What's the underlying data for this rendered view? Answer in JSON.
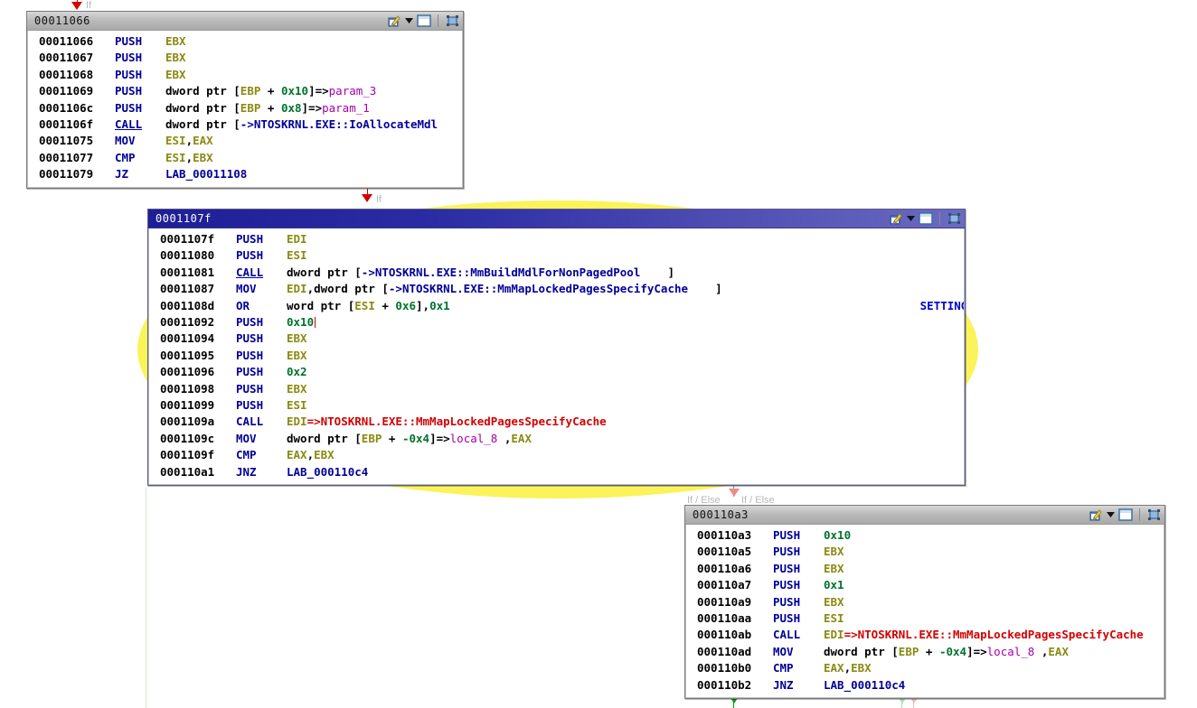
{
  "app": {
    "view": "function-graph",
    "accent_blue": "#00009a",
    "accent_red": "#d40000",
    "highlight_yellow": "#fbf35a",
    "register_olive": "#8a8a12",
    "number_green": "#00722a",
    "variable_magenta": "#a800a8"
  },
  "edges": [
    {
      "id": "edge-into-block-1",
      "label": "If"
    },
    {
      "id": "edge-block1-to-block2",
      "label": "If"
    },
    {
      "id": "edge-block2-to-block3-a",
      "label": "If / Else"
    },
    {
      "id": "edge-block2-to-block3-b",
      "label": "If / Else"
    }
  ],
  "titlebar_icons": [
    {
      "name": "edit-highlight-icon",
      "glyph": ""
    },
    {
      "name": "chevron-down-icon",
      "glyph": "▾"
    },
    {
      "name": "window-restore-icon",
      "glyph": ""
    },
    {
      "name": "fit-to-window-icon",
      "glyph": ""
    }
  ],
  "blocks": [
    {
      "id": "block-00011066",
      "title": "00011066",
      "selected": false,
      "rows": [
        {
          "addr": "00011066",
          "mnem": "PUSH",
          "underline": false,
          "ops": [
            {
              "t": "reg",
              "v": "EBX"
            }
          ],
          "comment": ""
        },
        {
          "addr": "00011067",
          "mnem": "PUSH",
          "underline": false,
          "ops": [
            {
              "t": "reg",
              "v": "EBX"
            }
          ],
          "comment": ""
        },
        {
          "addr": "00011068",
          "mnem": "PUSH",
          "underline": false,
          "ops": [
            {
              "t": "reg",
              "v": "EBX"
            }
          ],
          "comment": ""
        },
        {
          "addr": "00011069",
          "mnem": "PUSH",
          "underline": false,
          "ops": [
            {
              "t": "plain",
              "v": "dword ptr ["
            },
            {
              "t": "reg",
              "v": "EBP"
            },
            {
              "t": "plain",
              "v": " + "
            },
            {
              "t": "num",
              "v": "0x10"
            },
            {
              "t": "plain",
              "v": "]=>"
            },
            {
              "t": "var",
              "v": "param_3"
            }
          ],
          "comment": ""
        },
        {
          "addr": "0001106c",
          "mnem": "PUSH",
          "underline": false,
          "ops": [
            {
              "t": "plain",
              "v": "dword ptr ["
            },
            {
              "t": "reg",
              "v": "EBP"
            },
            {
              "t": "plain",
              "v": " + "
            },
            {
              "t": "num",
              "v": "0x8"
            },
            {
              "t": "plain",
              "v": "]=>"
            },
            {
              "t": "var",
              "v": "param_1"
            }
          ],
          "comment": ""
        },
        {
          "addr": "0001106f",
          "mnem": "CALL",
          "underline": true,
          "ops": [
            {
              "t": "plain",
              "v": "dword ptr ["
            },
            {
              "t": "extref",
              "v": "->NTOSKRNL.EXE::IoAllocateMdl"
            },
            {
              "t": "plain",
              "v": "    ]"
            }
          ],
          "comment": ""
        },
        {
          "addr": "00011075",
          "mnem": "MOV",
          "underline": false,
          "ops": [
            {
              "t": "reg",
              "v": "ESI"
            },
            {
              "t": "plain",
              "v": ","
            },
            {
              "t": "reg",
              "v": "EAX"
            }
          ],
          "comment": ""
        },
        {
          "addr": "00011077",
          "mnem": "CMP",
          "underline": false,
          "ops": [
            {
              "t": "reg",
              "v": "ESI"
            },
            {
              "t": "plain",
              "v": ","
            },
            {
              "t": "reg",
              "v": "EBX"
            }
          ],
          "comment": ""
        },
        {
          "addr": "00011079",
          "mnem": "JZ",
          "underline": false,
          "ops": [
            {
              "t": "label",
              "v": "LAB_00011108"
            }
          ],
          "comment": ""
        }
      ]
    },
    {
      "id": "block-0001107f",
      "title": "0001107f",
      "selected": true,
      "rows": [
        {
          "addr": "0001107f",
          "mnem": "PUSH",
          "underline": false,
          "ops": [
            {
              "t": "reg",
              "v": "EDI"
            }
          ],
          "comment": ""
        },
        {
          "addr": "00011080",
          "mnem": "PUSH",
          "underline": false,
          "ops": [
            {
              "t": "reg",
              "v": "ESI"
            }
          ],
          "comment": ""
        },
        {
          "addr": "00011081",
          "mnem": "CALL",
          "underline": true,
          "ops": [
            {
              "t": "plain",
              "v": "dword ptr ["
            },
            {
              "t": "extref",
              "v": "->NTOSKRNL.EXE::MmBuildMdlForNonPagedPool"
            },
            {
              "t": "plain",
              "v": "    ]"
            }
          ],
          "comment": ""
        },
        {
          "addr": "00011087",
          "mnem": "MOV",
          "underline": false,
          "ops": [
            {
              "t": "reg",
              "v": "EDI"
            },
            {
              "t": "plain",
              "v": ",dword ptr ["
            },
            {
              "t": "extref",
              "v": "->NTOSKRNL.EXE::MmMapLockedPagesSpecifyCache"
            },
            {
              "t": "plain",
              "v": "    ]"
            }
          ],
          "comment": ""
        },
        {
          "addr": "0001108d",
          "mnem": "OR",
          "underline": false,
          "ops": [
            {
              "t": "plain",
              "v": "word ptr ["
            },
            {
              "t": "reg",
              "v": "ESI"
            },
            {
              "t": "plain",
              "v": " + "
            },
            {
              "t": "num",
              "v": "0x6"
            },
            {
              "t": "plain",
              "v": "],"
            },
            {
              "t": "num",
              "v": "0x1"
            }
          ],
          "comment": "SETTING MDL_MAPPED_TO_SYSTEM_VA"
        },
        {
          "addr": "00011092",
          "mnem": "PUSH",
          "underline": false,
          "ops": [
            {
              "t": "num",
              "v": "0x10"
            },
            {
              "t": "caret",
              "v": ""
            }
          ],
          "comment": ""
        },
        {
          "addr": "00011094",
          "mnem": "PUSH",
          "underline": false,
          "ops": [
            {
              "t": "reg",
              "v": "EBX"
            }
          ],
          "comment": ""
        },
        {
          "addr": "00011095",
          "mnem": "PUSH",
          "underline": false,
          "ops": [
            {
              "t": "reg",
              "v": "EBX"
            }
          ],
          "comment": ""
        },
        {
          "addr": "00011096",
          "mnem": "PUSH",
          "underline": false,
          "ops": [
            {
              "t": "num",
              "v": "0x2"
            }
          ],
          "comment": ""
        },
        {
          "addr": "00011098",
          "mnem": "PUSH",
          "underline": false,
          "ops": [
            {
              "t": "reg",
              "v": "EBX"
            }
          ],
          "comment": ""
        },
        {
          "addr": "00011099",
          "mnem": "PUSH",
          "underline": false,
          "ops": [
            {
              "t": "reg",
              "v": "ESI"
            }
          ],
          "comment": ""
        },
        {
          "addr": "0001109a",
          "mnem": "CALL",
          "underline": false,
          "ops": [
            {
              "t": "reg",
              "v": "EDI"
            },
            {
              "t": "red",
              "v": "=>NTOSKRNL.EXE::MmMapLockedPagesSpecifyCache"
            }
          ],
          "comment": ""
        },
        {
          "addr": "0001109c",
          "mnem": "MOV",
          "underline": false,
          "ops": [
            {
              "t": "plain",
              "v": "dword ptr ["
            },
            {
              "t": "reg",
              "v": "EBP"
            },
            {
              "t": "plain",
              "v": " + "
            },
            {
              "t": "num",
              "v": "-0x4"
            },
            {
              "t": "plain",
              "v": "]=>"
            },
            {
              "t": "var",
              "v": "local_8"
            },
            {
              "t": "plain",
              "v": " ,"
            },
            {
              "t": "reg",
              "v": "EAX"
            }
          ],
          "comment": ""
        },
        {
          "addr": "0001109f",
          "mnem": "CMP",
          "underline": false,
          "ops": [
            {
              "t": "reg",
              "v": "EAX"
            },
            {
              "t": "plain",
              "v": ","
            },
            {
              "t": "reg",
              "v": "EBX"
            }
          ],
          "comment": ""
        },
        {
          "addr": "000110a1",
          "mnem": "JNZ",
          "underline": false,
          "ops": [
            {
              "t": "label",
              "v": "LAB_000110c4"
            }
          ],
          "comment": ""
        }
      ]
    },
    {
      "id": "block-000110a3",
      "title": "000110a3",
      "selected": false,
      "rows": [
        {
          "addr": "000110a3",
          "mnem": "PUSH",
          "underline": false,
          "ops": [
            {
              "t": "num",
              "v": "0x10"
            }
          ],
          "comment": ""
        },
        {
          "addr": "000110a5",
          "mnem": "PUSH",
          "underline": false,
          "ops": [
            {
              "t": "reg",
              "v": "EBX"
            }
          ],
          "comment": ""
        },
        {
          "addr": "000110a6",
          "mnem": "PUSH",
          "underline": false,
          "ops": [
            {
              "t": "reg",
              "v": "EBX"
            }
          ],
          "comment": ""
        },
        {
          "addr": "000110a7",
          "mnem": "PUSH",
          "underline": false,
          "ops": [
            {
              "t": "num",
              "v": "0x1"
            }
          ],
          "comment": ""
        },
        {
          "addr": "000110a9",
          "mnem": "PUSH",
          "underline": false,
          "ops": [
            {
              "t": "reg",
              "v": "EBX"
            }
          ],
          "comment": ""
        },
        {
          "addr": "000110aa",
          "mnem": "PUSH",
          "underline": false,
          "ops": [
            {
              "t": "reg",
              "v": "ESI"
            }
          ],
          "comment": ""
        },
        {
          "addr": "000110ab",
          "mnem": "CALL",
          "underline": false,
          "ops": [
            {
              "t": "reg",
              "v": "EDI"
            },
            {
              "t": "red",
              "v": "=>NTOSKRNL.EXE::MmMapLockedPagesSpecifyCache"
            }
          ],
          "comment": ""
        },
        {
          "addr": "000110ad",
          "mnem": "MOV",
          "underline": false,
          "ops": [
            {
              "t": "plain",
              "v": "dword ptr ["
            },
            {
              "t": "reg",
              "v": "EBP"
            },
            {
              "t": "plain",
              "v": " + "
            },
            {
              "t": "num",
              "v": "-0x4"
            },
            {
              "t": "plain",
              "v": "]=>"
            },
            {
              "t": "var",
              "v": "local_8"
            },
            {
              "t": "plain",
              "v": " ,"
            },
            {
              "t": "reg",
              "v": "EAX"
            }
          ],
          "comment": ""
        },
        {
          "addr": "000110b0",
          "mnem": "CMP",
          "underline": false,
          "ops": [
            {
              "t": "reg",
              "v": "EAX"
            },
            {
              "t": "plain",
              "v": ","
            },
            {
              "t": "reg",
              "v": "EBX"
            }
          ],
          "comment": ""
        },
        {
          "addr": "000110b2",
          "mnem": "JNZ",
          "underline": false,
          "ops": [
            {
              "t": "label",
              "v": "LAB_000110c4"
            }
          ],
          "comment": ""
        }
      ]
    }
  ]
}
